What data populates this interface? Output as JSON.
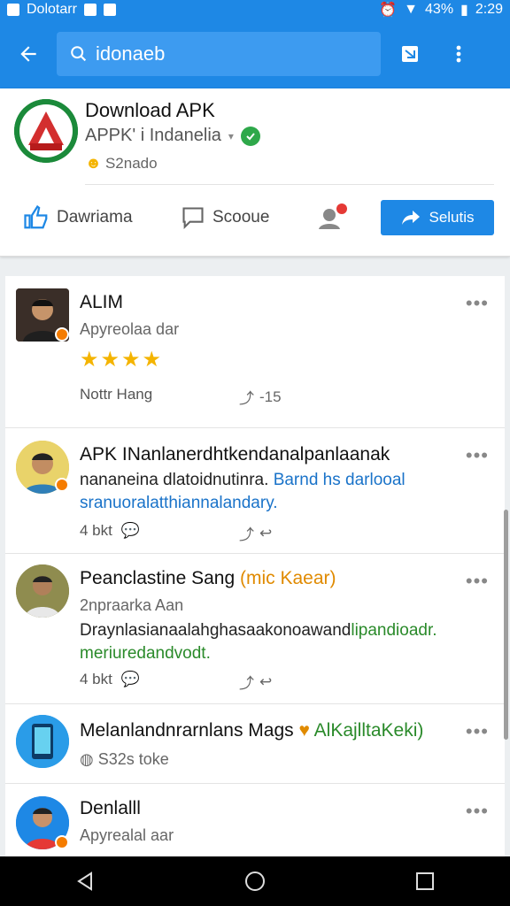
{
  "status_bar": {
    "app_label": "Dolotarr",
    "battery": "43%",
    "time": "2:29"
  },
  "search": {
    "query": "idonaeb"
  },
  "page": {
    "name": "Download APK",
    "subtitle": "APPK' i Indanelia",
    "meta": "S2nado",
    "actions": {
      "first": "Dawriama",
      "second": "Scooue",
      "primary": "Selutis"
    }
  },
  "posts": [
    {
      "title": "ALIM",
      "subtitle": "Apyreolaa dar",
      "rating": 4,
      "footer_left": "Nottr Hang",
      "footer_right": "-15"
    },
    {
      "title": "APK INanlanerdhtkendanalpanlaanak",
      "body_plain": "nananeina dlatoidnutinra.",
      "body_blue": "Barnd hs darlooal sranuoralatthiannalandary.",
      "footer_left": "4 bkt"
    },
    {
      "title": "Peanclastine Sang",
      "title_tag": "(mic Kaear)",
      "subtitle": "2npraarka Aan",
      "body_plain": "Draynlasianaalahghasaakonoawand",
      "body_green": "lipandioadr. meriuredandvodt.",
      "footer_left": "4 bkt"
    },
    {
      "title": "Melanlandnrarnlans Mags",
      "title_tag": "AlKajlltaKeki)",
      "subtitle": "S32s toke"
    },
    {
      "title": "Denlalll",
      "subtitle": "Apyrealal aar"
    }
  ],
  "colors": {
    "primary": "#1e88e5",
    "accent_orange": "#e08a00",
    "accent_green": "#2a8a2a",
    "star": "#f4b400"
  }
}
